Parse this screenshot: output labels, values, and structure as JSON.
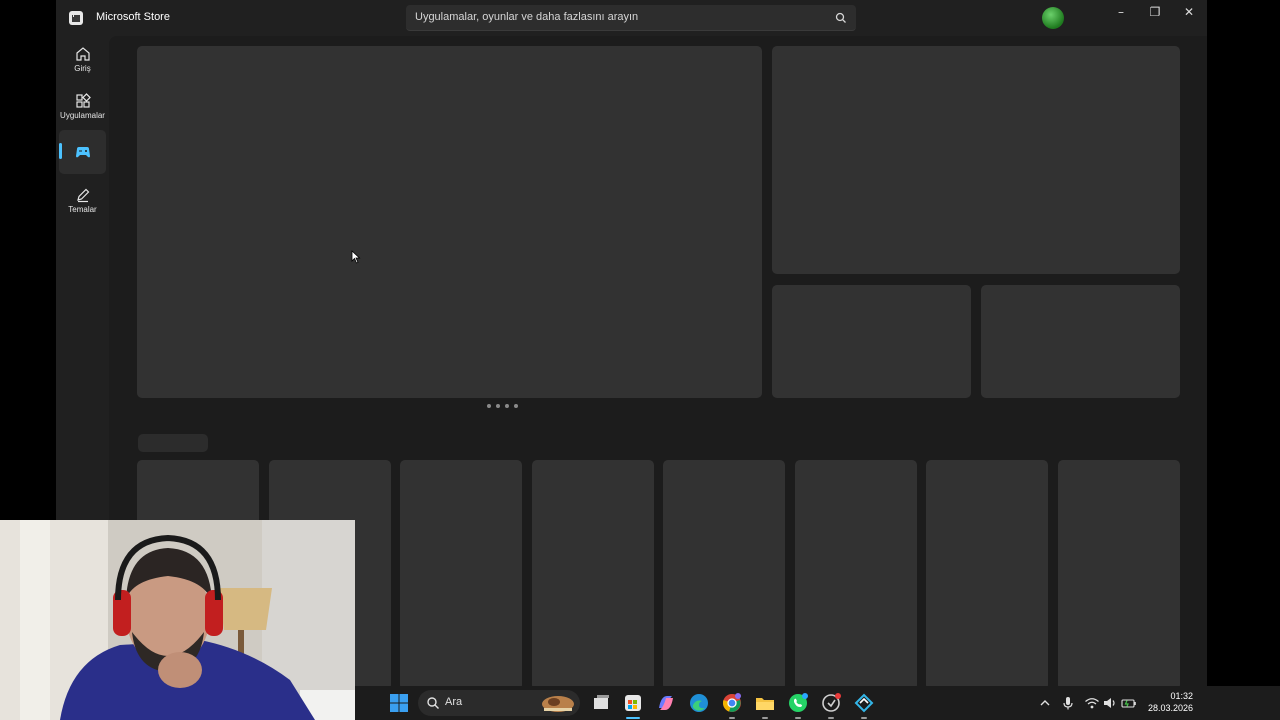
{
  "window": {
    "app_title": "Microsoft Store",
    "search_placeholder": "Uygulamalar, oyunlar ve daha fazlasını arayın",
    "controls": [
      "minimize",
      "restore",
      "close"
    ]
  },
  "nav": {
    "items": [
      {
        "label": "Giriş",
        "icon": "home-icon",
        "active": false
      },
      {
        "label": "Uygulamalar",
        "icon": "apps-icon",
        "active": false
      },
      {
        "label": "",
        "icon": "gaming-icon",
        "active": true
      },
      {
        "label": "Temalar",
        "icon": "pen-icon",
        "active": false
      }
    ]
  },
  "content": {
    "loading": true,
    "carousel_dots": 4
  },
  "taskbar": {
    "search_label": "Ara",
    "apps": [
      "start-icon",
      "search-icon",
      "widgets-image",
      "task-view-icon",
      "store-icon",
      "copilot-icon",
      "edge-icon",
      "chrome-icon",
      "file-explorer-icon",
      "whatsapp-icon",
      "app-icon",
      "vpn-icon"
    ],
    "tray": {
      "time": "01:32",
      "date": "28.03.2026",
      "icons": [
        "chevron-up-icon",
        "microphone-icon",
        "wifi-icon",
        "volume-icon",
        "battery-icon"
      ]
    }
  },
  "colors": {
    "window_bg": "#202020",
    "content_bg": "#1c1c1c",
    "placeholder": "#323232",
    "accent": "#4cc2ff"
  }
}
